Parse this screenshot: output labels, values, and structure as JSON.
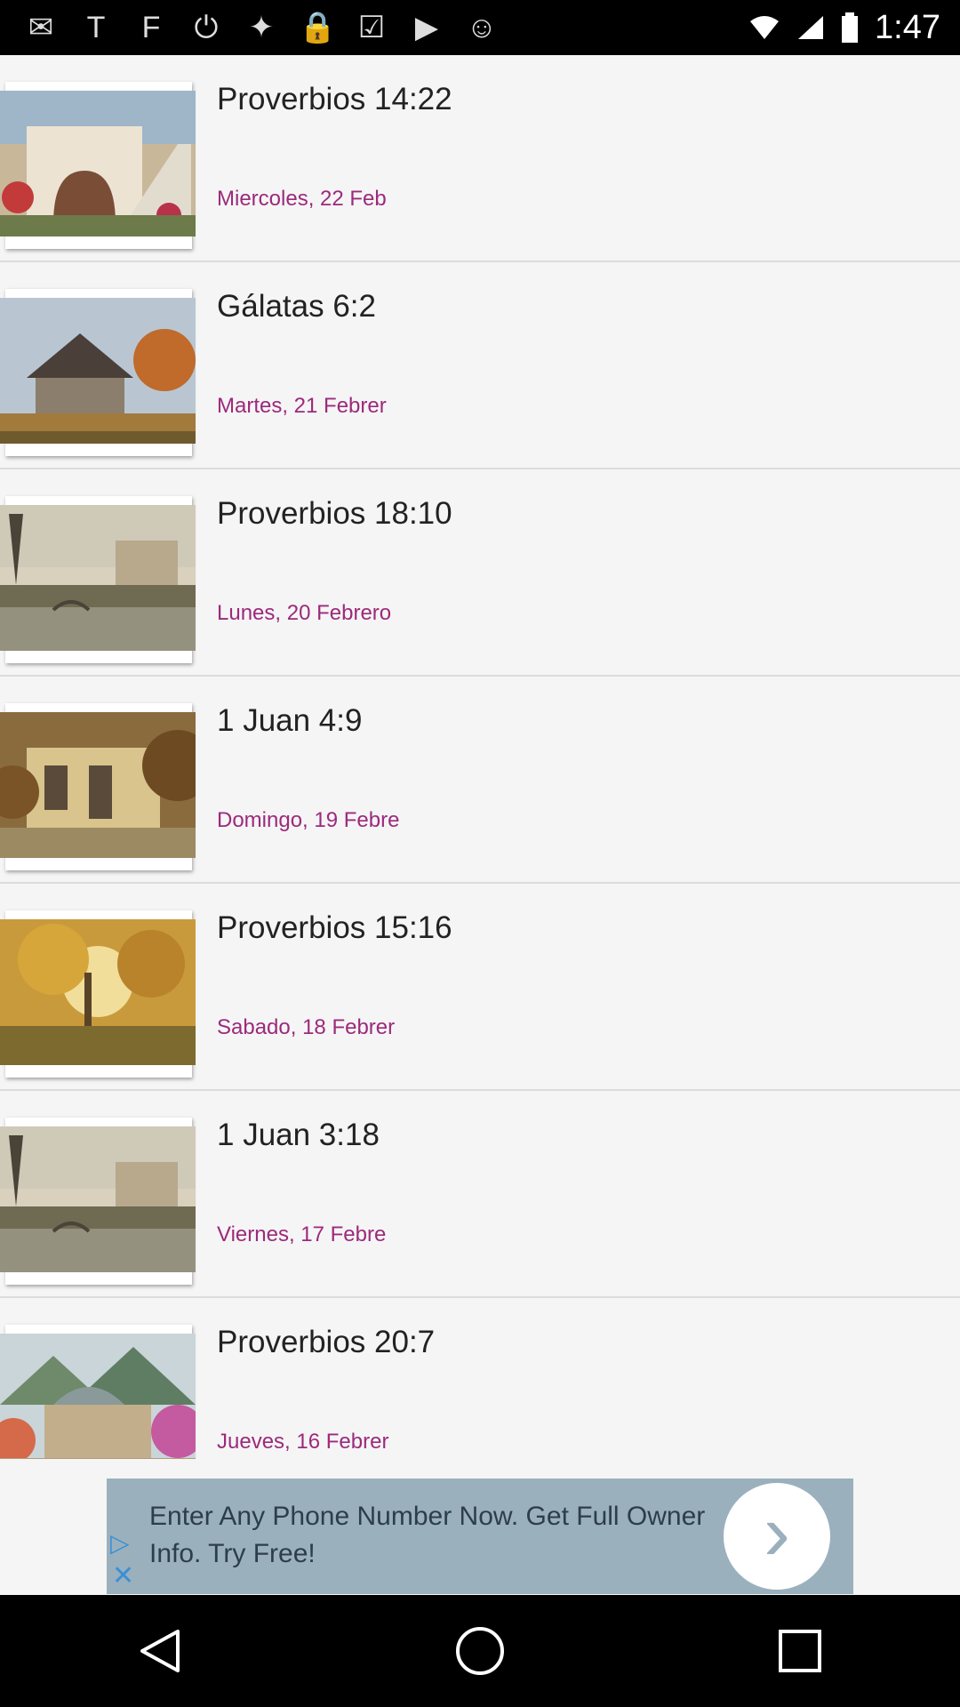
{
  "status_bar": {
    "time": "1:47",
    "icons": [
      "mail-icon",
      "text-icon",
      "flipboard-icon",
      "power-icon",
      "satellite-icon",
      "lock-icon",
      "clipboard-check-icon",
      "briefcase-play-icon",
      "android-icon"
    ],
    "icon_glyphs": [
      "✉",
      "T",
      "F",
      "⏻",
      "✦",
      "🔒",
      "☑",
      "▶",
      "☺"
    ]
  },
  "items": [
    {
      "title": "Proverbios 14:22",
      "date": "Miercoles, 22 Feb"
    },
    {
      "title": "Gálatas 6:2",
      "date": "Martes, 21 Febrer"
    },
    {
      "title": "Proverbios 18:10",
      "date": "Lunes, 20 Febrero"
    },
    {
      "title": "1 Juan 4:9",
      "date": "Domingo, 19 Febre"
    },
    {
      "title": "Proverbios 15:16",
      "date": "Sabado, 18 Febrer"
    },
    {
      "title": "1 Juan 3:18",
      "date": "Viernes, 17 Febre"
    },
    {
      "title": "Proverbios 20:7",
      "date": "Jueves, 16 Febrer"
    }
  ],
  "ad": {
    "text": "Enter Any Phone Number Now. Get Full Owner Info. Try Free!"
  },
  "colors": {
    "date_text": "#9c2a7c",
    "ad_background": "#9ab0bd"
  }
}
